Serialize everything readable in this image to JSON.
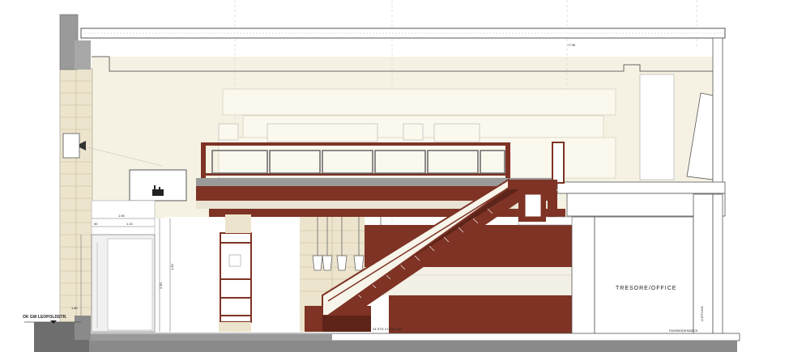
{
  "drawing": {
    "labels": {
      "room": "TRESORE/OFFICE",
      "street_level": "OK GW LEOPOLDSTR.",
      "level_mark": "+7.95",
      "stair_note": "24 STG 17.5/26 CM",
      "floor_note": "FASSBODENDECK",
      "lift": "LUFTUNG"
    },
    "dimensions": [
      "1.90",
      "50",
      "1.10",
      "1.50",
      "2.50",
      "1.80"
    ],
    "colors": {
      "cream": "#f6f2e3",
      "brown": "#7e3325",
      "dark_brown": "#5e2419",
      "stone": "#e6dfc9",
      "grey": "#8a8a8a",
      "line": "#555555"
    }
  }
}
